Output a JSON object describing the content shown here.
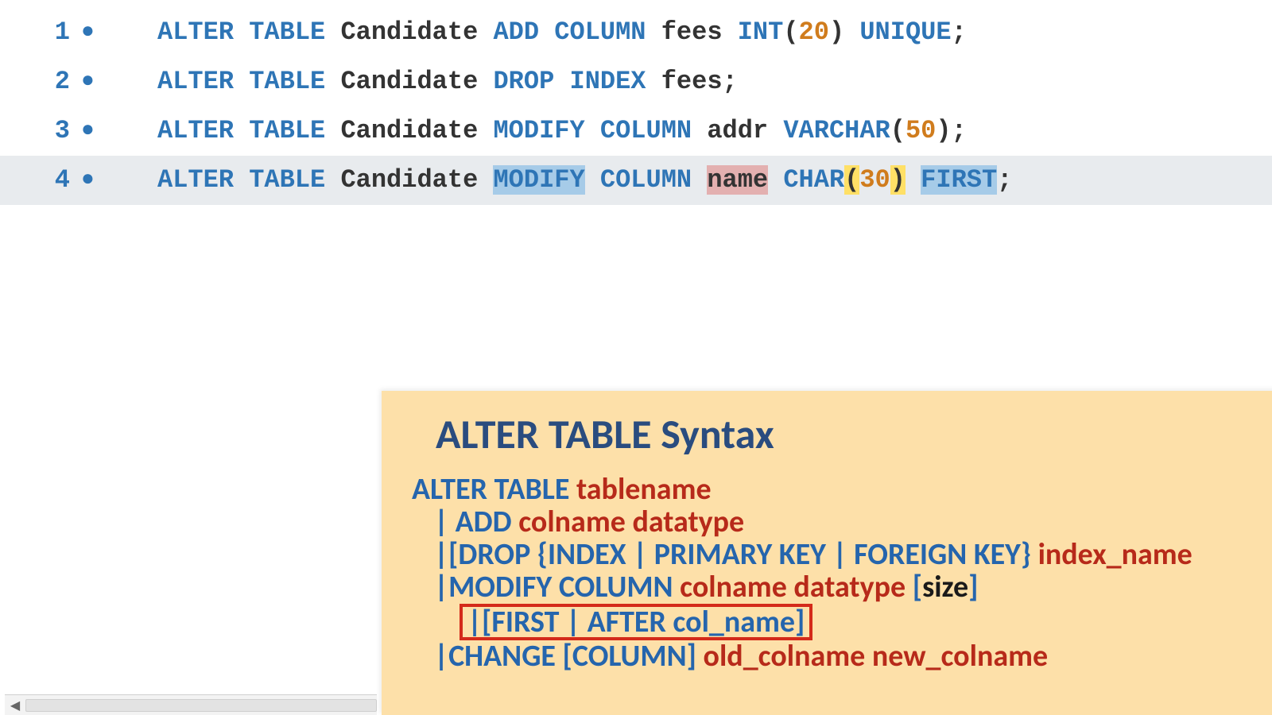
{
  "editor": {
    "lines": [
      {
        "num": "1",
        "bullet": "●"
      },
      {
        "num": "2",
        "bullet": "●"
      },
      {
        "num": "3",
        "bullet": "●"
      },
      {
        "num": "4",
        "bullet": "●"
      }
    ],
    "l1": {
      "kw1": "ALTER",
      "kw2": "TABLE",
      "tbl": "Candidate",
      "kw3": "ADD",
      "kw4": "COLUMN",
      "col": "fees",
      "ty": "INT",
      "lp": "(",
      "n": "20",
      "rp": ")",
      "kw5": "UNIQUE",
      "semi": ";"
    },
    "l2": {
      "kw1": "ALTER",
      "kw2": "TABLE",
      "tbl": "Candidate",
      "kw3": "DROP",
      "kw4": "INDEX",
      "col": "fees",
      "semi": ";"
    },
    "l3": {
      "kw1": "ALTER",
      "kw2": "TABLE",
      "tbl": "Candidate",
      "kw3": "MODIFY",
      "kw4": "COLUMN",
      "col": "addr",
      "ty": "VARCHAR",
      "lp": "(",
      "n": "50",
      "rp": ")",
      "semi": ";"
    },
    "l4": {
      "kw1": "ALTER",
      "kw2": "TABLE",
      "tbl": "Candidate",
      "kw3": "MODIFY",
      "kw4": "COLUMN",
      "col": "name",
      "ty": "CHAR",
      "lp": "(",
      "n": "30",
      "rp": ")",
      "kw5": "FIRST",
      "semi": ";"
    }
  },
  "popup": {
    "title": "ALTER TABLE Syntax",
    "r1": {
      "p1": "ALTER  TABLE ",
      "p2": "tablename"
    },
    "r2": {
      "p1": "| ",
      "p2": "ADD ",
      "p3": "colname datatype"
    },
    "r3": {
      "p1": "|[",
      "p2": "DROP {INDEX | PRIMARY KEY | FOREIGN KEY} ",
      "p3": "index_name"
    },
    "r4": {
      "p1": "|",
      "p2": "MODIFY COLUMN ",
      "p3": "colname  datatype ",
      "p4": "[",
      "p5": "size",
      "p6": "]"
    },
    "r5": {
      "p1": "|[FIRST | AFTER col_name]"
    },
    "r6": {
      "p1": "|",
      "p2": "CHANGE [COLUMN] ",
      "p3": "old_colname new_colname"
    }
  },
  "icons": {
    "bullet": "●",
    "left_arrow": "◀"
  }
}
